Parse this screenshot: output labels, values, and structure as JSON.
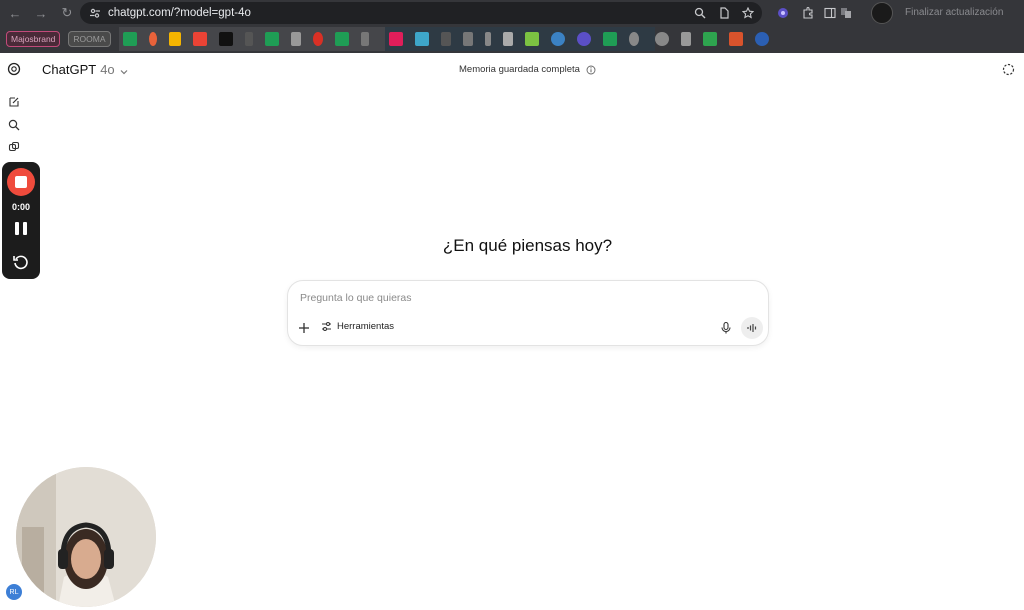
{
  "browser": {
    "url": "chatgpt.com/?model=gpt-4o",
    "update_label": "Finalizar actualización",
    "bookmarks": {
      "chip1": "Majosbrand",
      "chip2": "ROOMA"
    }
  },
  "app": {
    "model_name": "ChatGPT",
    "model_version": "4o",
    "memory_status": "Memoria guardada completa",
    "greeting": "¿En qué piensas hoy?",
    "composer": {
      "placeholder": "Pregunta lo que quieras",
      "tools_label": "Herramientas"
    },
    "avatar_initials": "RL"
  },
  "recorder": {
    "time": "0:00"
  },
  "colors": {
    "chrome_bg": "#35363a",
    "record_red": "#ef4b3c",
    "avatar_blue": "#3d7fd6"
  }
}
